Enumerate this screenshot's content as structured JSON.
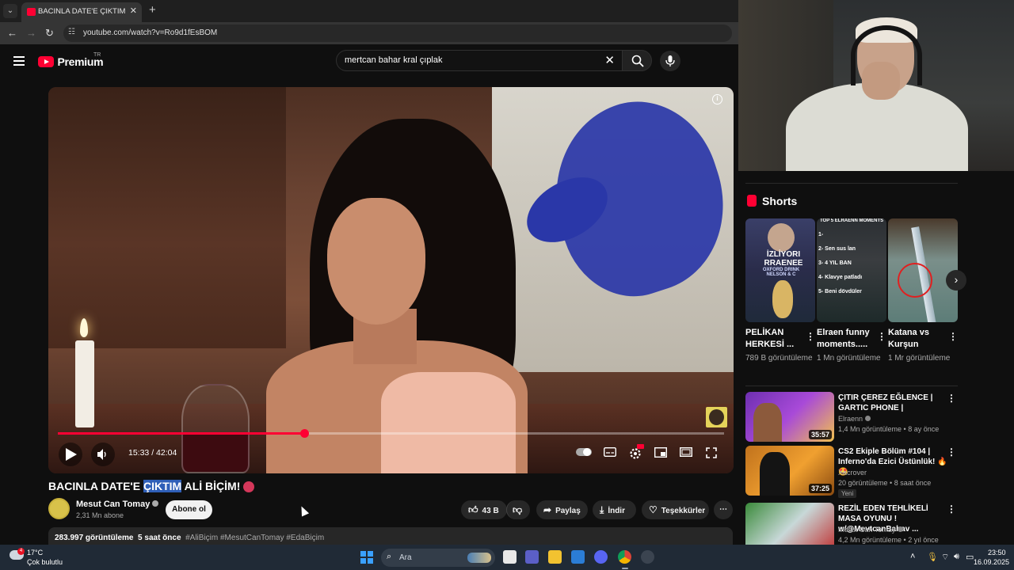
{
  "browser": {
    "tab_title": "BACINLA DATE'E ÇIKTIM ALİ BİÇİ",
    "tab_close": "✕",
    "new_tab": "+",
    "url": "youtube.com/watch?v=Ro9d1fEsBOM"
  },
  "header": {
    "logo": "Premium",
    "country": "TR",
    "search_query": "mertcan bahar kral çıplak"
  },
  "player": {
    "current_time": "15:33",
    "duration": "42:04",
    "time_display": "15:33 / 42:04",
    "progress_fraction": 0.37
  },
  "video": {
    "title_before": "BACINLA DATE'E ",
    "title_highlight": "ÇIKTIM",
    "title_after": " ALİ BİÇİM!",
    "channel_name": "Mesut Can Tomay",
    "subscribers": "2,31 Mn abone",
    "subscribe_label": "Abone ol",
    "likes": "43 B",
    "share_label": "Paylaş",
    "download_label": "İndir",
    "thanks_label": "Teşekkürler",
    "views": "283.997 görüntüleme",
    "published": "5 saat önce",
    "hashtags": "#AliBiçim #MesutCanTomay #EdaBiçim"
  },
  "shorts": {
    "heading": "Shorts",
    "items": [
      {
        "title": "PELİKAN HERKESİ ...",
        "views": "789 B görüntüleme",
        "thumb_text": "İZLİYORI RRAENEE",
        "thumb_sub": "OXFORD DRINK NELSON & C"
      },
      {
        "title": "Elraen funny moments.....",
        "views": "1 Mn görüntüleme",
        "thumb_text": "TOP 5 ELRAENN MOMENTS",
        "thumb_list": [
          "1-",
          "2- Sen sus lan",
          "3- 4 YIL BAN",
          "4- Klavye patladı",
          "5- Beni dövdüler"
        ]
      },
      {
        "title": "Katana vs Kurşun",
        "views": "1 Mr görüntüleme"
      }
    ]
  },
  "recommendations": [
    {
      "title": "ÇITIR ÇEREZ EĞLENCE | GARTIC PHONE |",
      "channel": "Elraenn",
      "meta": "1,4 Mn görüntüleme • 8 ay önce",
      "duration": "35:57",
      "badge": ""
    },
    {
      "title": "CS2 Ekiple Bölüm #104 | Inferno'da Ezici Üstünlük! 🔥 🤩",
      "channel": "Xacrover",
      "meta": "20 görüntüleme • 8 saat önce",
      "duration": "37:25",
      "badge": "Yeni"
    },
    {
      "title": "REZİL EDEN TEHLİKELİ MASA OYUNU ! w/@MevtcanBahav ...",
      "channel": "Mesut Can Tomay",
      "meta": "4,2 Mn görüntüleme • 2 yıl önce",
      "duration": "",
      "badge": ""
    }
  ],
  "taskbar": {
    "temperature": "17°C",
    "weather": "Çok bulutlu",
    "weather_badge": "4",
    "search_label": "Ara",
    "time": "23:50",
    "date": "16.09.2025"
  },
  "colors": {
    "accent": "#ff0033",
    "background": "#0f0f0f",
    "highlight": "#2f5fb8"
  }
}
